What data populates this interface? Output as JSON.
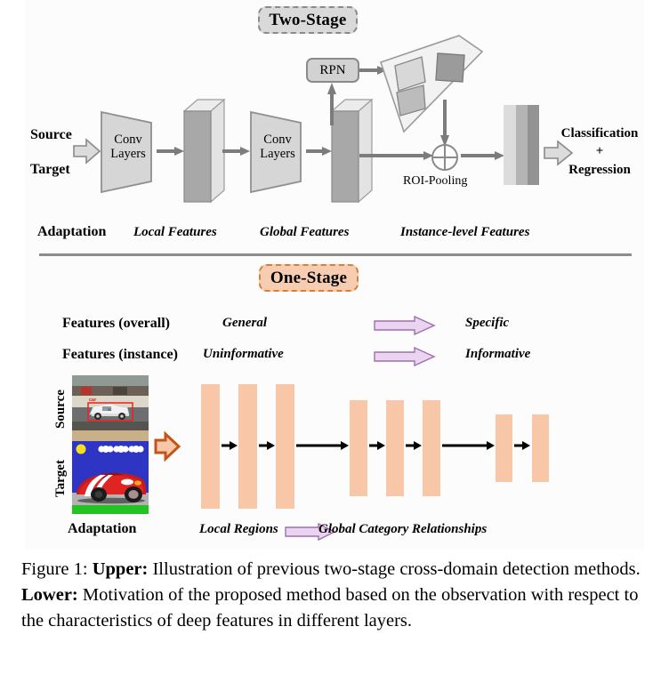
{
  "figure": {
    "caption_prefix": "Figure 1:",
    "caption_upper_tag": "Upper:",
    "caption_upper_text": " Illustration of previous two-stage cross-domain detection methods. ",
    "caption_lower_tag": "Lower:",
    "caption_lower_text": " Motivation of the proposed method based on the observation with respect to the characteristics of deep features in different layers."
  },
  "upper": {
    "title": "Two-Stage",
    "source_label": "Source",
    "target_label": "Target",
    "conv1_line1": "Conv",
    "conv1_line2": "Layers",
    "conv2_line1": "Conv",
    "conv2_line2": "Layers",
    "rpn": "RPN",
    "roi_pooling": "ROI-Pooling",
    "output_line1": "Classification",
    "output_line2": "+",
    "output_line3": "Regression",
    "footer": {
      "adaptation": "Adaptation",
      "local_features": "Local Features",
      "global_features": "Global Features",
      "instance_features": "Instance-level Features"
    }
  },
  "lower": {
    "title": "One-Stage",
    "rows": [
      {
        "name": "Features (overall)",
        "from": "General",
        "to": "Specific"
      },
      {
        "name": "Features (instance)",
        "from": "Uninformative",
        "to": "Informative"
      }
    ],
    "source_label": "Source",
    "target_label": "Target",
    "footer": {
      "adaptation": "Adaptation",
      "local_regions": "Local Regions",
      "global_category": "Global Category Relationships"
    }
  },
  "colors": {
    "two_stage_fill": "#d9d9d9",
    "two_stage_border": "#8a8a8a",
    "one_stage_fill": "#f6cdb0",
    "one_stage_border": "#d2813c",
    "peach_bar": "#f7c7a7",
    "purple_arrow_fill": "#ead4f0",
    "purple_arrow_stroke": "#9d6fae",
    "orange_arrow": "#c2551a",
    "slab_front": "#a8a8a8",
    "slab_side": "#e3e3e3",
    "gray_stroke": "#8a8a8a",
    "bbox_red": "#e8231f"
  },
  "icons": {
    "block_arrow": "block-arrow-right-icon",
    "purple_arrow": "purple-arrow-right-icon",
    "orange_arrow": "orange-block-arrow-icon",
    "roi_circle": "roi-pooling-crosshair-icon"
  },
  "source_image": {
    "description": "race-car-photo",
    "bbox_class_label": "car"
  },
  "target_image": {
    "description": "cartoon-red-sports-car"
  }
}
